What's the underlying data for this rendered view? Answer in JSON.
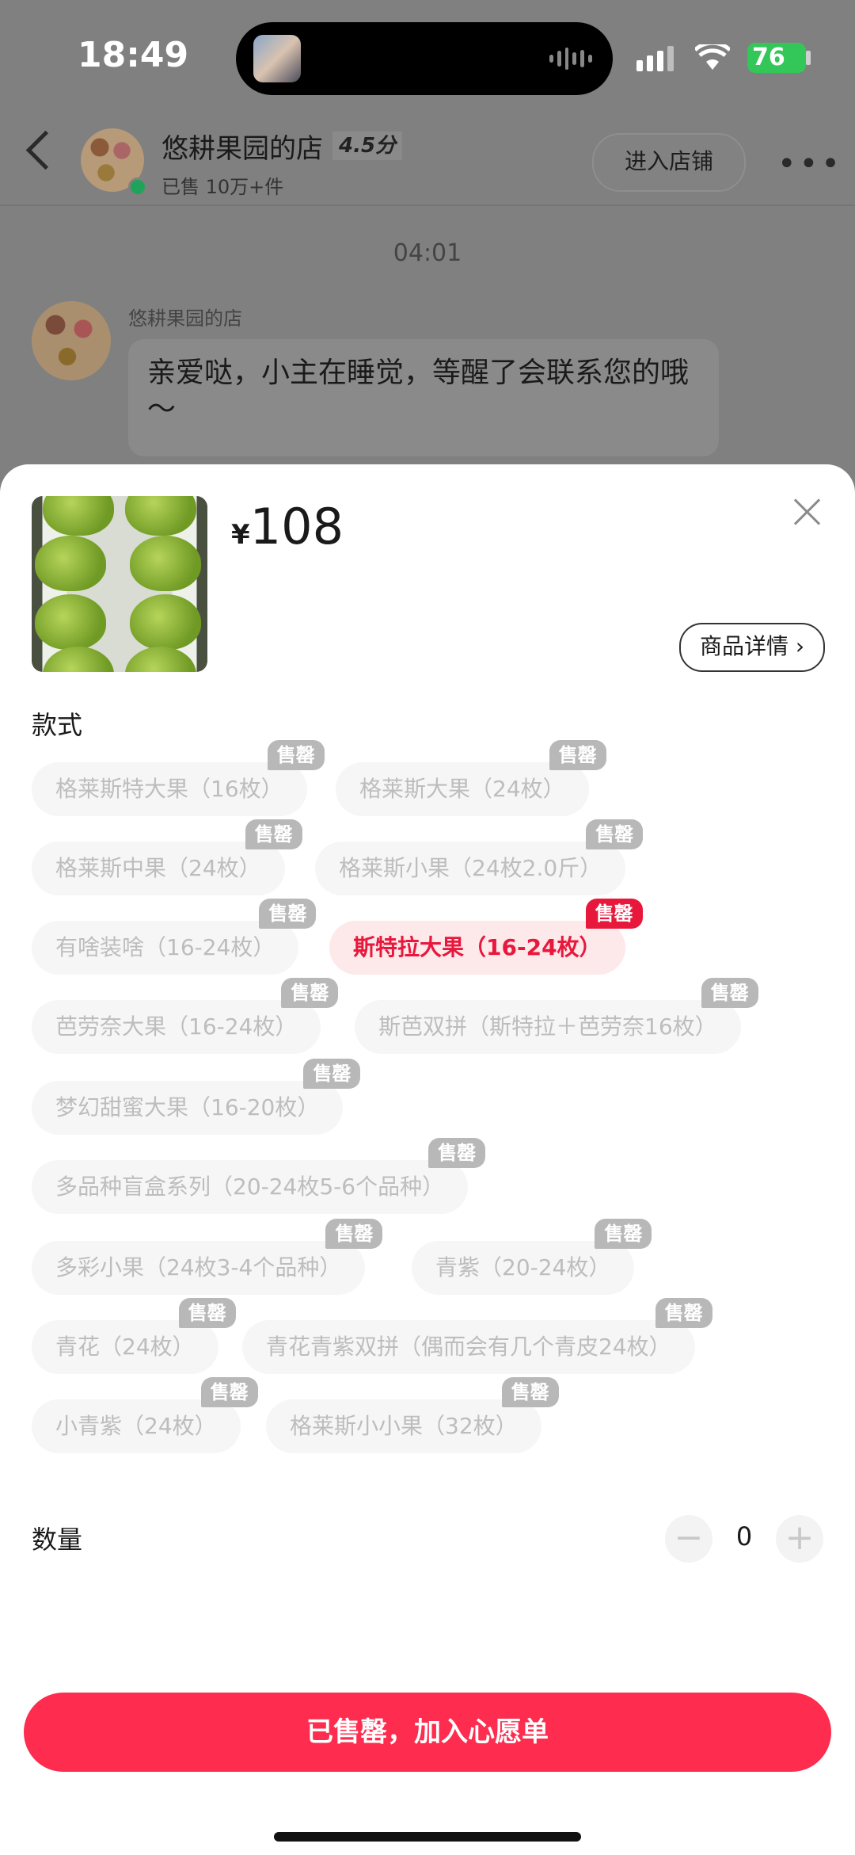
{
  "status_bar": {
    "time": "18:49",
    "battery": "76"
  },
  "chat_header": {
    "shop_name": "悠耕果园的店",
    "rating": "4.5分",
    "sold": "已售 10万+件",
    "enter_shop_label": "进入店铺"
  },
  "chat": {
    "timestamp": "04:01",
    "sender": "悠耕果园的店",
    "message": "亲爱哒，小主在睡觉，等醒了会联系您的哦～"
  },
  "sheet": {
    "currency": "¥",
    "price": "108",
    "detail_label": "商品详情",
    "style_label": "款式",
    "sold_out_badge": "售罄",
    "options": [
      "格莱斯特大果（16枚）",
      "格莱斯大果（24枚）",
      "格莱斯中果（24枚）",
      "格莱斯小果（24枚2.0斤）",
      "有啥装啥（16-24枚）",
      "斯特拉大果（16-24枚）",
      "芭劳奈大果（16-24枚）",
      "斯芭双拼（斯特拉＋芭劳奈16枚）",
      "梦幻甜蜜大果（16-20枚）",
      "多品种盲盒系列（20-24枚5-6个品种）",
      "多彩小果（24枚3-4个品种）",
      "青紫（20-24枚）",
      "青花（24枚）",
      "青花青紫双拼（偶而会有几个青皮24枚）",
      "小青紫（24枚）",
      "格莱斯小小果（32枚）"
    ],
    "selected_option": "斯特拉大果（16-24枚）",
    "quantity_label": "数量",
    "quantity": "0",
    "minus": "−",
    "plus": "+",
    "cta_label": "已售罄，加入心愿单"
  }
}
